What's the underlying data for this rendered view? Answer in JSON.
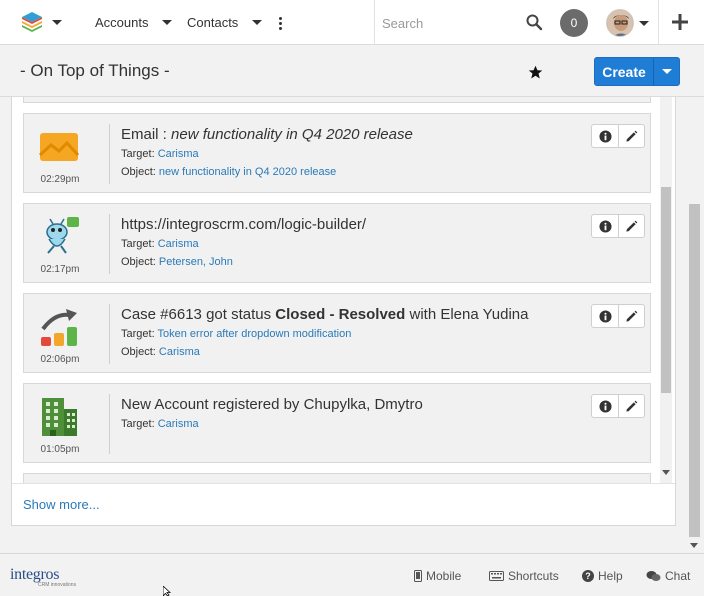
{
  "navbar": {
    "tabs": [
      {
        "label": "Accounts"
      },
      {
        "label": "Contacts"
      }
    ],
    "search_placeholder": "Search",
    "notifications_count": "0",
    "icons": {
      "menu": "layers-logo-icon",
      "search": "search-icon",
      "add": "plus-icon",
      "more": "more-vertical-icon"
    }
  },
  "header": {
    "title": "- On Top of Things -",
    "create_label": "Create"
  },
  "feed": {
    "items": [
      {
        "icon": "email-envelope-icon",
        "time": "02:29pm",
        "title_prefix": "Email : ",
        "title_italic": "new functionality in Q4 2020 release",
        "target_label": "Target: ",
        "target_value": "Carisma",
        "object_label": "Object: ",
        "object_value": "new functionality in Q4 2020 release"
      },
      {
        "icon": "logic-builder-mascot-icon",
        "time": "02:17pm",
        "title_prefix": "https://integroscrm.com/logic-builder/",
        "target_label": "Target: ",
        "target_value": "Carisma",
        "object_label": "Object: ",
        "object_value": "Petersen, John"
      },
      {
        "icon": "case-status-chart-icon",
        "time": "02:06pm",
        "title_prefix": "Case #6613 got status ",
        "title_bold": "Closed - Resolved",
        "title_suffix": " with Elena Yudina",
        "target_label": "Target: ",
        "target_value": "Token error after dropdown modification",
        "object_label": "Object: ",
        "object_value": "Carisma"
      },
      {
        "icon": "building-icon",
        "time": "01:05pm",
        "title_prefix": "New Account registered by Chupylka, Dmytro",
        "target_label": "Target: ",
        "target_value": "Carisma"
      }
    ],
    "show_more": "Show more..."
  },
  "footer": {
    "brand": "integros",
    "brand_tagline": "CRM innovations",
    "links": {
      "mobile": "Mobile",
      "shortcuts": "Shortcuts",
      "help": "Help",
      "chat": "Chat"
    }
  },
  "colors": {
    "accent": "#1f7dd6",
    "link": "#2a7ab8"
  }
}
